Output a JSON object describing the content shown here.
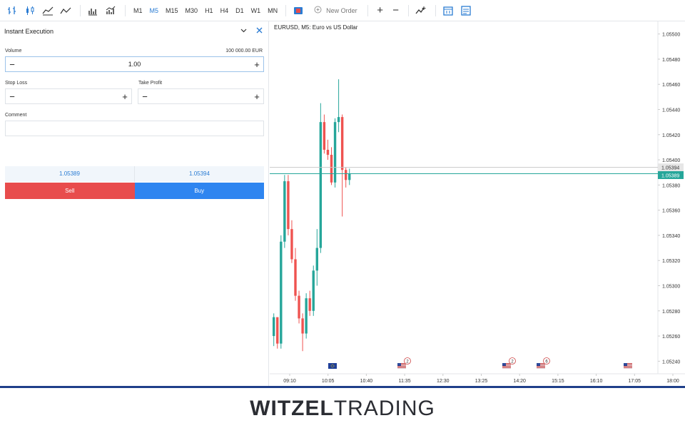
{
  "toolbar": {
    "timeframes": [
      "M1",
      "M5",
      "M15",
      "M30",
      "H1",
      "H4",
      "D1",
      "W1",
      "MN"
    ],
    "active_timeframe": "M5",
    "new_order_label": "New Order"
  },
  "panel": {
    "title": "Instant Execution",
    "volume_label": "Volume",
    "volume_value": "1.00",
    "volume_amount": "100 000.00 EUR",
    "stop_loss_label": "Stop Loss",
    "take_profit_label": "Take Profit",
    "comment_label": "Comment",
    "bid": "1.05389",
    "ask": "1.05394",
    "sell_label": "Sell",
    "buy_label": "Buy"
  },
  "chart": {
    "title": "EURUSD, M5: Euro vs US Dollar",
    "price_labels": [
      "1.05500",
      "1.05480",
      "1.05460",
      "1.05440",
      "1.05420",
      "1.05400",
      "1.05380",
      "1.05360",
      "1.05340",
      "1.05320",
      "1.05300",
      "1.05280",
      "1.05260",
      "1.05240"
    ],
    "ask_tag": "1.05394",
    "bid_tag": "1.05389",
    "time_labels": [
      "09:10",
      "10:05",
      "10:40",
      "11:35",
      "12:30",
      "13:25",
      "14:20",
      "15:15",
      "16:10",
      "17:05",
      "18:00"
    ],
    "events": [
      {
        "flag": "eu",
        "count": ""
      },
      {
        "flag": "us",
        "count": "2"
      },
      {
        "flag": "us",
        "count": "2"
      },
      {
        "flag": "us",
        "count": "6"
      },
      {
        "flag": "us",
        "count": ""
      }
    ]
  },
  "chart_data": {
    "type": "candlestick",
    "title": "EURUSD, M5: Euro vs US Dollar",
    "ylim": [
      1.0523,
      1.0551
    ],
    "candles": [
      {
        "o": 1.0526,
        "h": 1.05278,
        "l": 1.05252,
        "c": 1.05275
      },
      {
        "o": 1.05275,
        "h": 1.05272,
        "l": 1.0525,
        "c": 1.05254
      },
      {
        "o": 1.05254,
        "h": 1.0534,
        "l": 1.0525,
        "c": 1.05335
      },
      {
        "o": 1.05335,
        "h": 1.05388,
        "l": 1.0533,
        "c": 1.05383
      },
      {
        "o": 1.05383,
        "h": 1.05388,
        "l": 1.0534,
        "c": 1.05345
      },
      {
        "o": 1.05345,
        "h": 1.05352,
        "l": 1.05318,
        "c": 1.05321
      },
      {
        "o": 1.05321,
        "h": 1.0533,
        "l": 1.05288,
        "c": 1.05292
      },
      {
        "o": 1.05292,
        "h": 1.05296,
        "l": 1.0527,
        "c": 1.05274
      },
      {
        "o": 1.05274,
        "h": 1.05278,
        "l": 1.05248,
        "c": 1.05262
      },
      {
        "o": 1.05262,
        "h": 1.05294,
        "l": 1.05258,
        "c": 1.0529
      },
      {
        "o": 1.0529,
        "h": 1.05296,
        "l": 1.05276,
        "c": 1.0528
      },
      {
        "o": 1.0528,
        "h": 1.05316,
        "l": 1.05276,
        "c": 1.05312
      },
      {
        "o": 1.05312,
        "h": 1.05345,
        "l": 1.053,
        "c": 1.0533
      },
      {
        "o": 1.0533,
        "h": 1.05445,
        "l": 1.05326,
        "c": 1.0543
      },
      {
        "o": 1.0543,
        "h": 1.05436,
        "l": 1.05405,
        "c": 1.05408
      },
      {
        "o": 1.05408,
        "h": 1.05416,
        "l": 1.054,
        "c": 1.05404
      },
      {
        "o": 1.05404,
        "h": 1.0541,
        "l": 1.0538,
        "c": 1.05382
      },
      {
        "o": 1.05382,
        "h": 1.05433,
        "l": 1.05378,
        "c": 1.0543
      },
      {
        "o": 1.0543,
        "h": 1.05464,
        "l": 1.05422,
        "c": 1.05434
      },
      {
        "o": 1.05434,
        "h": 1.05436,
        "l": 1.05355,
        "c": 1.05392
      },
      {
        "o": 1.05392,
        "h": 1.05394,
        "l": 1.05378,
        "c": 1.05384
      },
      {
        "o": 1.05384,
        "h": 1.05393,
        "l": 1.0538,
        "c": 1.05389
      }
    ],
    "bid_line": 1.05389,
    "ask_line": 1.05394
  },
  "footer": {
    "brand_bold": "WITZEL",
    "brand_rest": "TRADING"
  }
}
